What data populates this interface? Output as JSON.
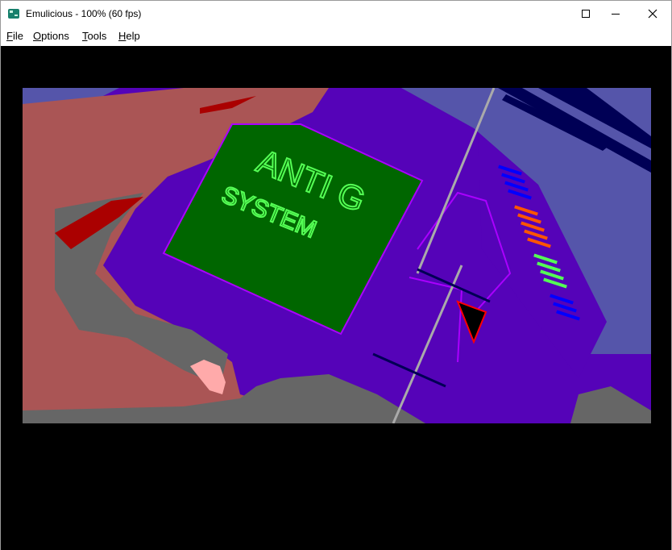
{
  "window": {
    "title": "Emulicious - 100% (60 fps)",
    "controls": {
      "minimize": "minimize-icon",
      "maximize": "maximize-icon",
      "close": "close-icon"
    }
  },
  "menu": {
    "items": [
      {
        "key": "F",
        "rest": "ile"
      },
      {
        "key": "O",
        "rest": "ptions"
      },
      {
        "key": "T",
        "rest": "ools"
      },
      {
        "key": "H",
        "rest": "elp"
      }
    ]
  },
  "game_screen": {
    "screen_text_line1": "ANTI G",
    "screen_text_line2": "SYSTEM",
    "colors": {
      "background": "#000000",
      "device": "#5503b8",
      "screen": "#006600",
      "screen_text": "#55ff55",
      "skin": "#aa5555",
      "shadow": "#666666",
      "sky": "#5555aa"
    }
  }
}
